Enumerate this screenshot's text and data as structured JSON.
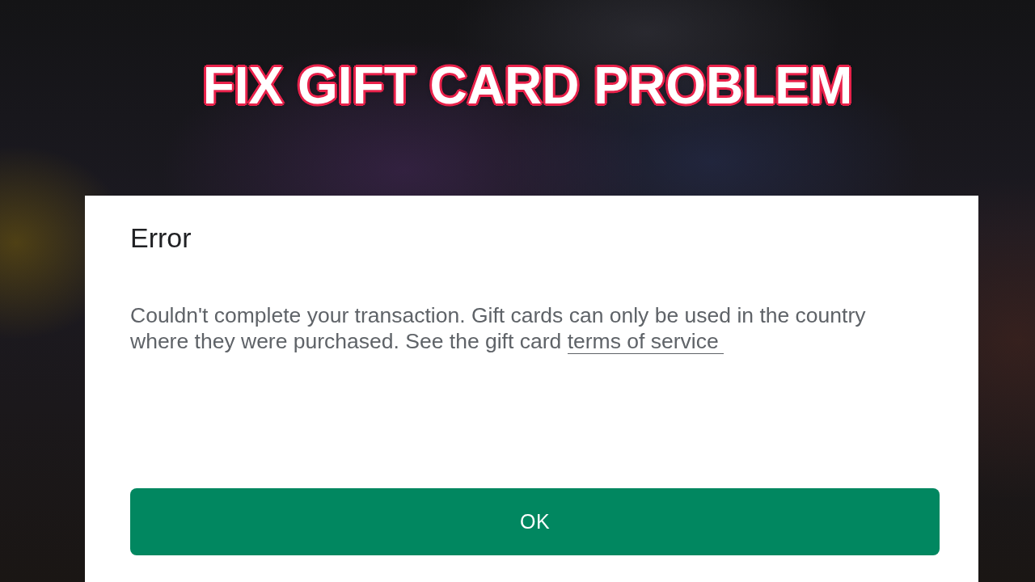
{
  "banner": {
    "title": "FIX GIFT CARD PROBLEM"
  },
  "dialog": {
    "title": "Error",
    "message": {
      "text": "Couldn't complete your transaction. Gift cards can only be used in the country where they were purchased. See the gift card",
      "link": "terms of service"
    },
    "buttons": [
      "OK"
    ]
  }
}
